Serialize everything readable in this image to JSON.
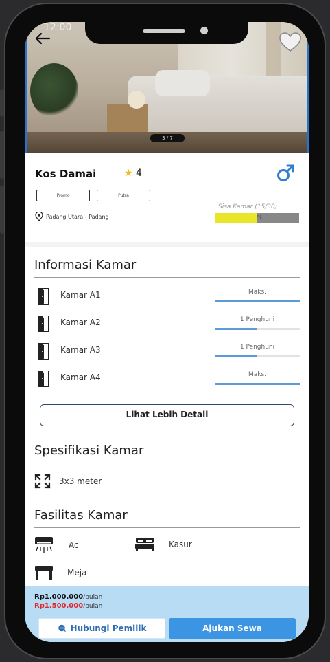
{
  "status_bar": {
    "time": "12:00"
  },
  "gallery": {
    "page_indicator": "3 / 7"
  },
  "listing": {
    "name": "Kos Damai",
    "rating": "4",
    "tags": [
      "Promo",
      "Putra"
    ],
    "location": "Padang Utara - Padang",
    "sisa_kamar_label": "Sisa Kamar (15/30)",
    "occupancy_fraction": 0.5,
    "occupancy_label": "%"
  },
  "informasi_kamar": {
    "title": "Informasi Kamar",
    "rooms": [
      {
        "name": "Kamar A1",
        "status": "Maks.",
        "fill": 1.0
      },
      {
        "name": "Kamar A2",
        "status": "1 Penghuni",
        "fill": 0.5
      },
      {
        "name": "Kamar A3",
        "status": "1 Penghuni",
        "fill": 0.5
      },
      {
        "name": "Kamar A4",
        "status": "Maks.",
        "fill": 1.0
      }
    ],
    "detail_button": "Lihat Lebih Detail"
  },
  "spesifikasi": {
    "title": "Spesifikasi Kamar",
    "size": "3x3 meter"
  },
  "fasilitas": {
    "title": "Fasilitas Kamar",
    "items": [
      {
        "label": "Ac",
        "icon": "ac-icon"
      },
      {
        "label": "Kasur",
        "icon": "bed-icon"
      },
      {
        "label": "Meja",
        "icon": "table-icon"
      }
    ]
  },
  "pricing": {
    "price_now": "Rp1.000.000",
    "price_old": "Rp1.500.000",
    "unit": "/bulan"
  },
  "actions": {
    "contact": "Hubungi Pemilik",
    "apply": "Ajukan Sewa"
  },
  "colors": {
    "accent": "#3b95e3",
    "bottom_bar": "#b9dcf5",
    "progress_fill": "#e9e62a",
    "price_old": "#e3262b"
  }
}
